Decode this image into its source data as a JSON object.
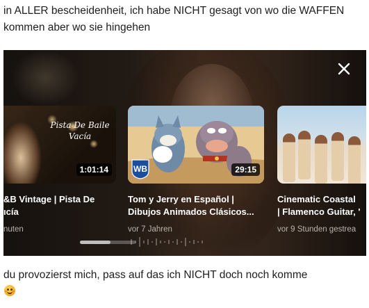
{
  "post": {
    "text_top": "in ALLER bescheidenheit, ich habe NICHT gesagt von wo die WAFFEN kommen aber wo sie hingehen",
    "text_bottom": "du provozierst mich, pass auf das ich NICHT doch noch komme",
    "emoji": "smiling-face-with-blush"
  },
  "player": {
    "close_icon": "close-icon",
    "progress": 0.55,
    "cards": [
      {
        "title_line1": "&B Vintage | Pista De",
        "title_line2": "ıcía",
        "meta": "nuten",
        "duration": "1:01:14",
        "overlay_text": "Pista De Baile Vacía"
      },
      {
        "title_line1": "Tom y Jerry en Español |",
        "title_line2": "Dibujos Animados Clásicos...",
        "meta": "vor 7 Jahren",
        "duration": "29:15",
        "badge": "WB"
      },
      {
        "title_line1": "Cinematic Coastal",
        "title_line2": "| Flamenco Guitar, '",
        "meta": "vor 9 Stunden gestrea"
      }
    ]
  },
  "colors": {
    "panel_bg": "#2a211a",
    "duration_bg": "#000000",
    "wb_blue": "#1a4fa0"
  }
}
